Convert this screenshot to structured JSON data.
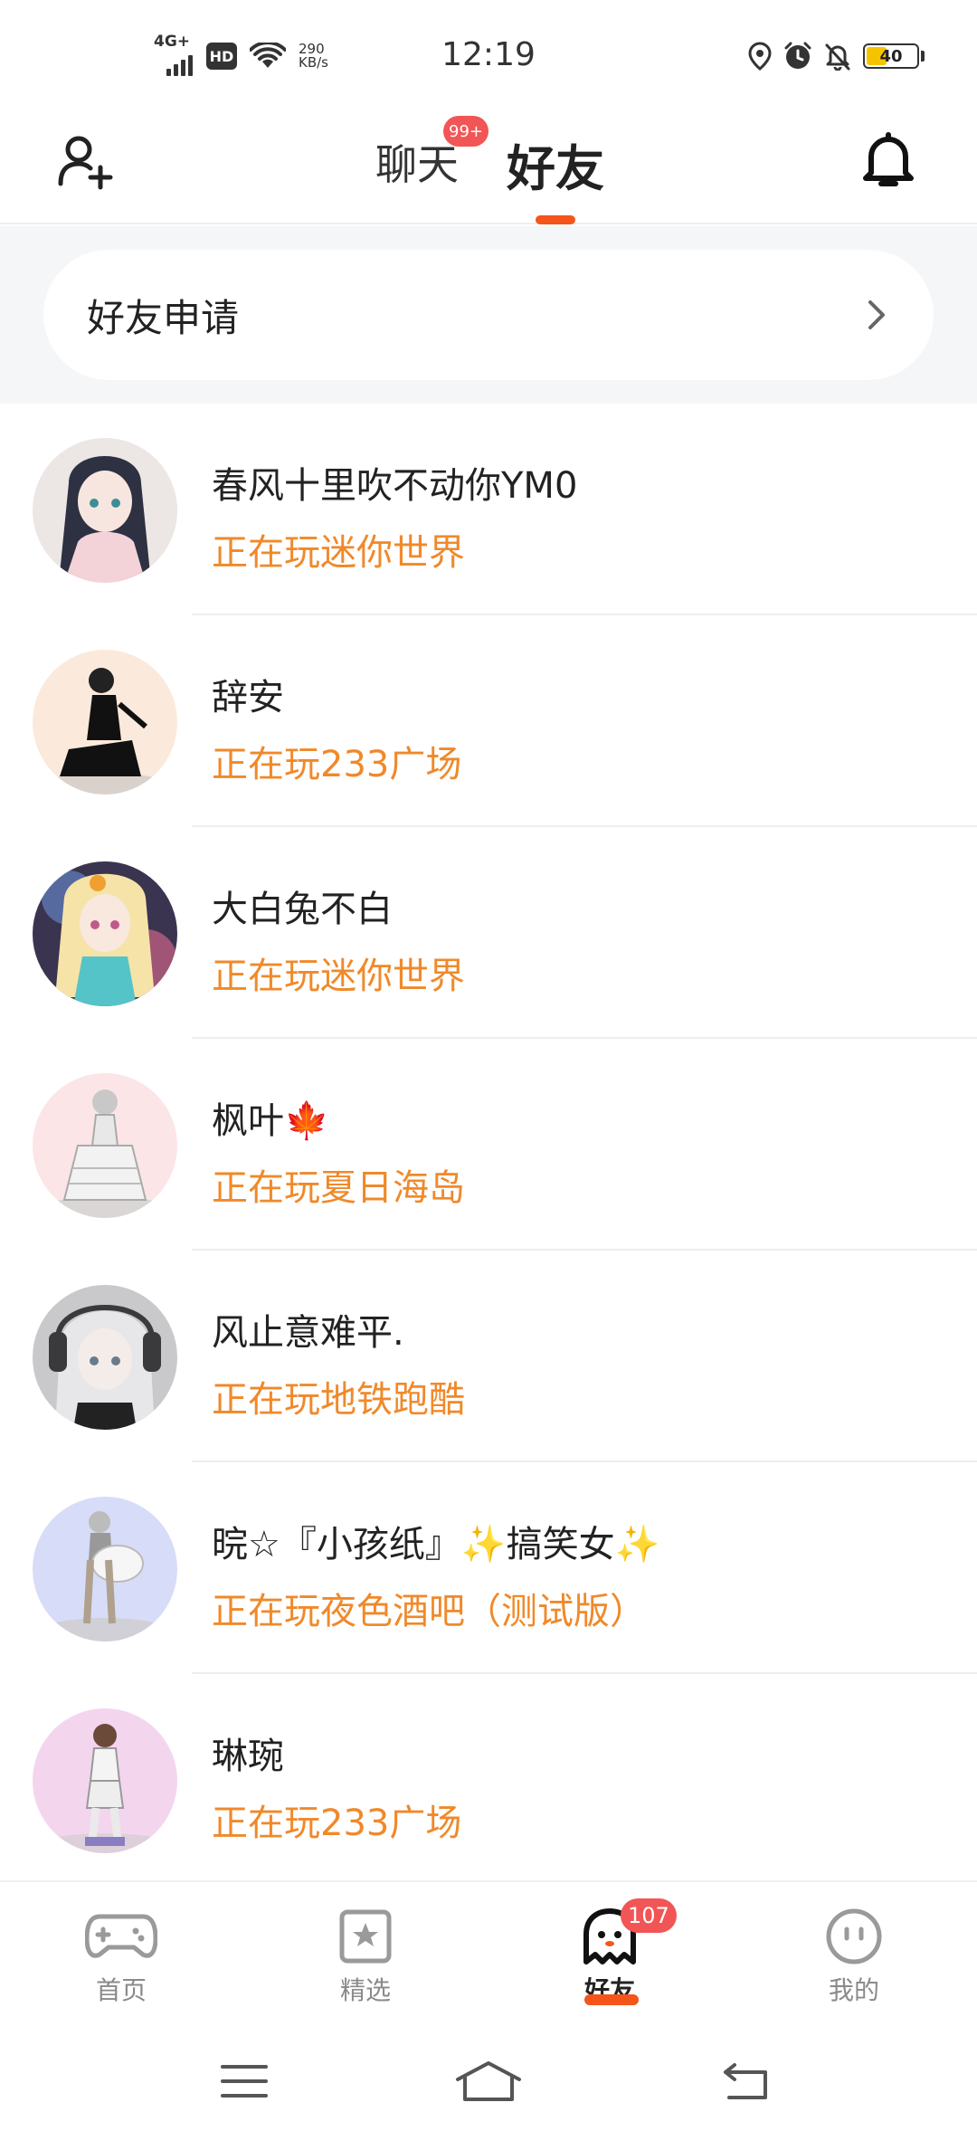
{
  "status_bar": {
    "network": "4G+",
    "hd": "HD",
    "speed_value": "290",
    "speed_unit": "KB/s",
    "time": "12:19",
    "battery": "40",
    "battery_level": 0.4,
    "icons": [
      "location-icon",
      "alarm-icon",
      "mute-bell-icon"
    ]
  },
  "header": {
    "tab_chat": "聊天",
    "chat_badge": "99+",
    "tab_friends": "好友",
    "accent_color": "#f5541b"
  },
  "friend_request": {
    "label": "好友申请"
  },
  "friends": [
    {
      "name": "春风十里吹不动你YM0",
      "status": "正在玩迷你世界"
    },
    {
      "name": "辞安",
      "status": "正在玩233广场"
    },
    {
      "name": "大白兔不白",
      "status": "正在玩迷你世界"
    },
    {
      "name": "枫叶🍁",
      "status": "正在玩夏日海岛"
    },
    {
      "name": "风止意难平.",
      "status": "正在玩地铁跑酷"
    },
    {
      "name": "晥☆『小孩纸』✨搞笑女✨",
      "status": "正在玩夜色酒吧（测试版）"
    },
    {
      "name": "琳琬",
      "status": "正在玩233广场"
    }
  ],
  "bottom_nav": {
    "home": "首页",
    "featured": "精选",
    "friends": "好友",
    "friends_badge": "107",
    "me": "我的"
  },
  "colors": {
    "status_text": "#f0892a",
    "badge": "#f25555"
  }
}
